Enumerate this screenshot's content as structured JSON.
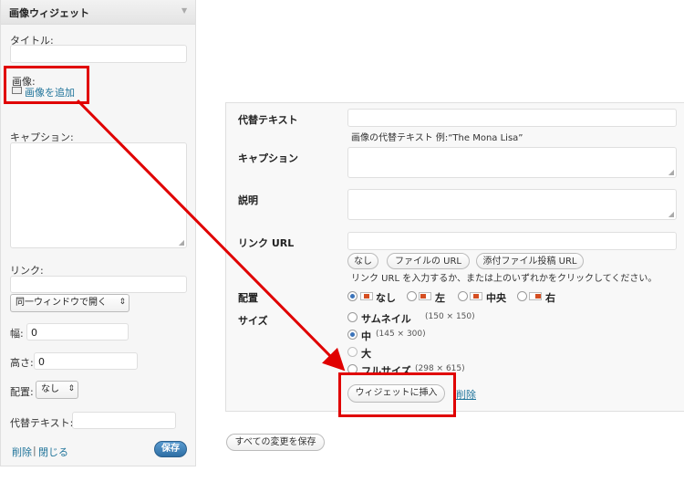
{
  "widget": {
    "title": "画像ウィジェット",
    "title_label": "タイトル:",
    "image_label": "画像:",
    "add_image_link": "画像を追加",
    "caption_label": "キャプション:",
    "link_label": "リンク:",
    "link_target_select": "同一ウィンドウで開く",
    "width_label": "幅:",
    "width_value": "0",
    "height_label": "高さ:",
    "height_value": "0",
    "align_label": "配置:",
    "align_select": "なし",
    "alt_label": "代替テキスト:",
    "delete_link": "削除",
    "separator": "|",
    "close_link": "閉じる",
    "save_button": "保存"
  },
  "media_form": {
    "alt_label": "代替テキスト",
    "alt_help": "画像の代替テキスト 例:“The Mona Lisa”",
    "caption_label": "キャプション",
    "description_label": "説明",
    "link_url_label": "リンク URL",
    "link_buttons": [
      "なし",
      "ファイルの URL",
      "添付ファイル投稿 URL"
    ],
    "link_help": "リンク URL を入力するか、または上のいずれかをクリックしてください。",
    "align_label": "配置",
    "align_options": [
      {
        "label": "なし",
        "selected": true
      },
      {
        "label": "左",
        "selected": false
      },
      {
        "label": "中央",
        "selected": false
      },
      {
        "label": "右",
        "selected": false
      }
    ],
    "size_label": "サイズ",
    "size_options": [
      {
        "label": "サムネイル",
        "meta": "(150 × 150)",
        "selected": false
      },
      {
        "label": "中",
        "meta": "(145 × 300)",
        "selected": true
      },
      {
        "label": "大",
        "meta": "",
        "selected": false
      },
      {
        "label": "フルサイズ",
        "meta": "(298 × 615)",
        "selected": false
      }
    ],
    "insert_button": "ウィジェットに挿入",
    "delete_link": "削除"
  },
  "save_all_button": "すべての変更を保存",
  "colors": {
    "annotation_red": "#e00000",
    "link_blue": "#21759b",
    "save_blue": "#2e6fa5"
  }
}
